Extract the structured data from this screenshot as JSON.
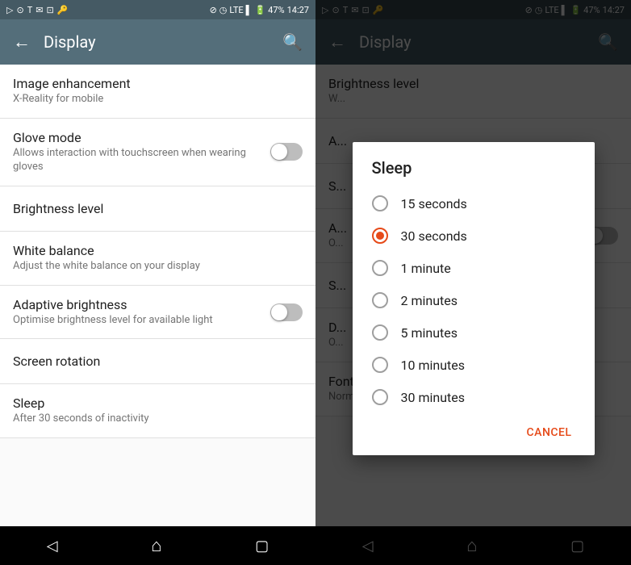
{
  "left_panel": {
    "status_bar": {
      "time": "14:27",
      "battery": "47%"
    },
    "toolbar": {
      "title": "Display",
      "back_label": "←",
      "search_label": "🔍"
    },
    "settings": [
      {
        "id": "image-enhancement",
        "title": "Image enhancement",
        "subtitle": "X-Reality for mobile",
        "has_toggle": false
      },
      {
        "id": "glove-mode",
        "title": "Glove mode",
        "subtitle": "Allows interaction with touchscreen when wearing gloves",
        "has_toggle": true,
        "toggle_on": false
      },
      {
        "id": "brightness-level",
        "title": "Brightness level",
        "subtitle": "",
        "has_toggle": false
      },
      {
        "id": "white-balance",
        "title": "White balance",
        "subtitle": "Adjust the white balance on your display",
        "has_toggle": false
      },
      {
        "id": "adaptive-brightness",
        "title": "Adaptive brightness",
        "subtitle": "Optimise brightness level for available light",
        "has_toggle": true,
        "toggle_on": false
      },
      {
        "id": "screen-rotation",
        "title": "Screen rotation",
        "subtitle": "",
        "has_toggle": false
      },
      {
        "id": "sleep",
        "title": "Sleep",
        "subtitle": "After 30 seconds of inactivity",
        "has_toggle": false
      }
    ],
    "nav_bar": {
      "back": "◁",
      "home": "⌂",
      "recents": "▢"
    }
  },
  "right_panel": {
    "status_bar": {
      "time": "14:27",
      "battery": "47%"
    },
    "toolbar": {
      "title": "Display",
      "back_label": "←",
      "search_label": "🔍"
    },
    "blurred_items": [
      {
        "title": "Brightness level",
        "subtitle": "W..."
      },
      {
        "title": "A..."
      },
      {
        "title": "S..."
      },
      {
        "title": "A..."
      },
      {
        "title": "S..."
      },
      {
        "title": "O..."
      },
      {
        "title": "D..."
      },
      {
        "title": "O..."
      },
      {
        "title": "Font size",
        "subtitle": "Normal"
      }
    ],
    "dialog": {
      "title": "Sleep",
      "options": [
        {
          "id": "15s",
          "label": "15 seconds",
          "selected": false
        },
        {
          "id": "30s",
          "label": "30 seconds",
          "selected": true
        },
        {
          "id": "1m",
          "label": "1 minute",
          "selected": false
        },
        {
          "id": "2m",
          "label": "2 minutes",
          "selected": false
        },
        {
          "id": "5m",
          "label": "5 minutes",
          "selected": false
        },
        {
          "id": "10m",
          "label": "10 minutes",
          "selected": false
        },
        {
          "id": "30m",
          "label": "30 minutes",
          "selected": false
        }
      ],
      "cancel_label": "CANCEL"
    },
    "nav_bar": {
      "back": "◁",
      "home": "⌂",
      "recents": "▢"
    }
  }
}
